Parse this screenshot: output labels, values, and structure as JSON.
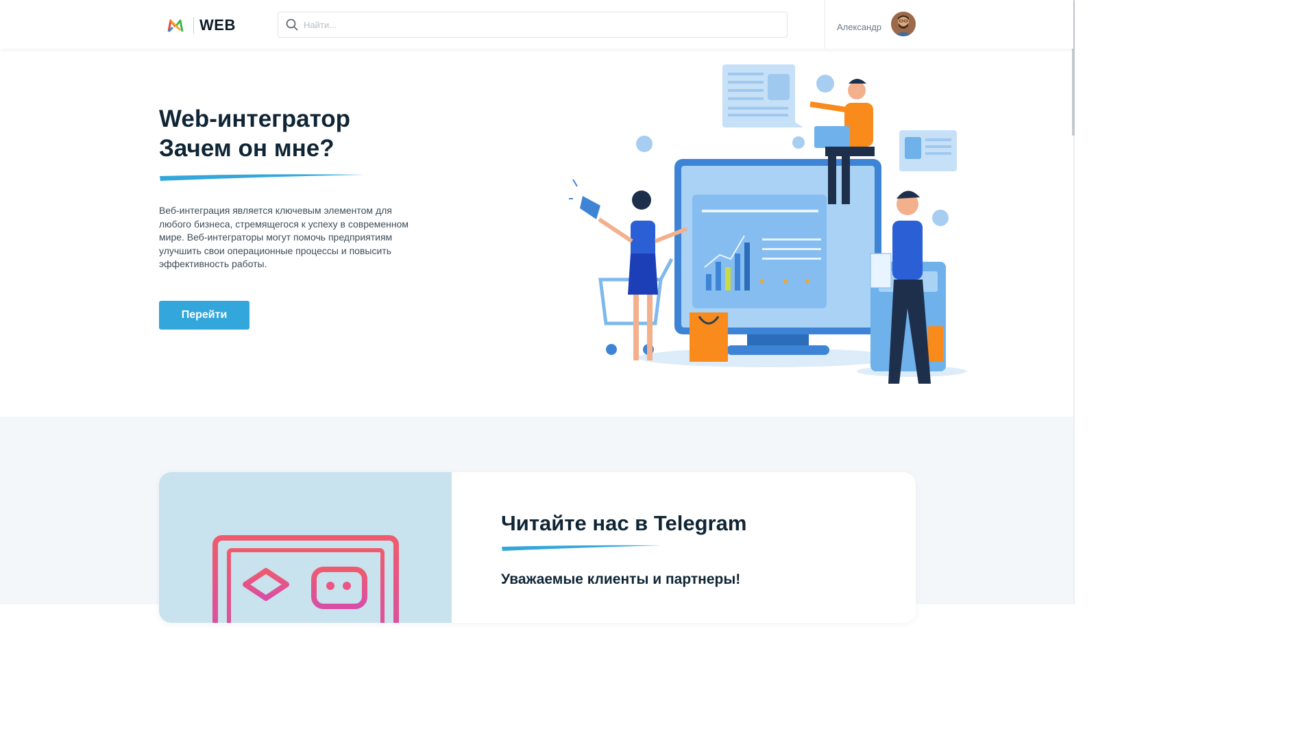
{
  "header": {
    "logo_text": "WEB",
    "search_placeholder": "Найти...",
    "user_name": "Александр"
  },
  "hero": {
    "title_line1": "Web-интегратор",
    "title_line2": "Зачем он мне?",
    "description": "Веб-интеграция является ключевым элементом для любого бизнеса, стремящегося к успеху в современном мире. Веб-интеграторы могут помочь предприятиям улучшить свои операционные процессы и повысить эффективность работы.",
    "button_label": "Перейти"
  },
  "telegram_card": {
    "title": "Читайте нас в Telegram",
    "subtitle": "Уважаемые клиенты и партнеры!"
  },
  "colors": {
    "accent": "#33a7dc",
    "title": "#0f2535",
    "card_left_bg": "#c8e2ee",
    "icon_pink": "#e8577c"
  },
  "icons": [
    "logo-icon",
    "search-icon",
    "avatar",
    "telegram-integration-icon"
  ]
}
